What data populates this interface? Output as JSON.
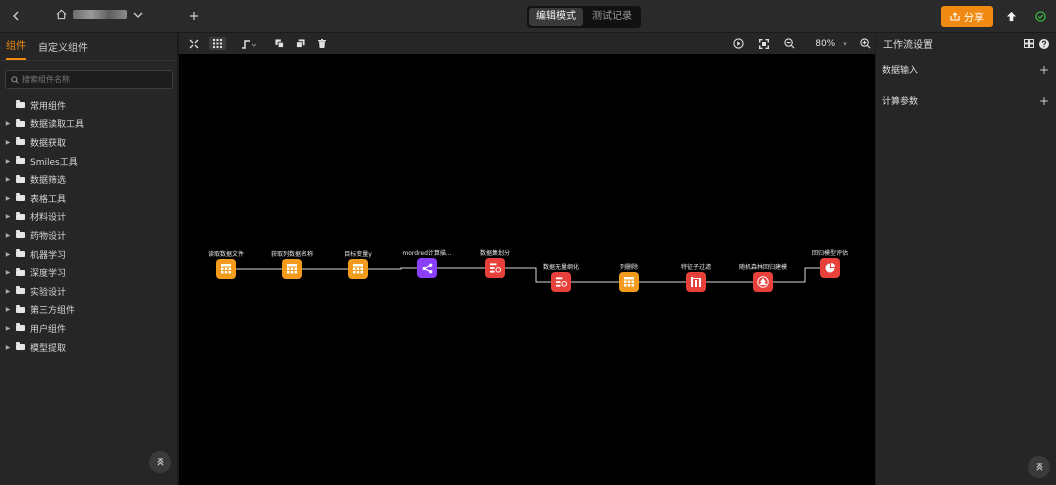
{
  "topbar": {
    "back_icon": "chevron-left-icon",
    "home_icon": "home-icon",
    "add_icon": "plus-icon",
    "modes": [
      "编辑模式",
      "测试记录"
    ],
    "active_mode": 0,
    "share_label": "分享",
    "share_icon": "share-icon",
    "push_icon": "upload-icon",
    "status_icon": "check-circle-icon"
  },
  "colors": {
    "accent": "#f08a12",
    "node_orange": "#f39b1c",
    "node_purple": "#8a3ffc",
    "node_red": "#e8413c"
  },
  "left_panel": {
    "tabs": [
      "组件",
      "自定义组件"
    ],
    "active_tab": 0,
    "search_placeholder": "搜索组件名称",
    "tree": [
      {
        "label": "常用组件",
        "expandable": false
      },
      {
        "label": "数据读取工具",
        "expandable": true
      },
      {
        "label": "数据获取",
        "expandable": true
      },
      {
        "label": "Smiles工具",
        "expandable": true
      },
      {
        "label": "数据筛选",
        "expandable": true
      },
      {
        "label": "表格工具",
        "expandable": true
      },
      {
        "label": "材料设计",
        "expandable": true
      },
      {
        "label": "药物设计",
        "expandable": true
      },
      {
        "label": "机器学习",
        "expandable": true
      },
      {
        "label": "深度学习",
        "expandable": true
      },
      {
        "label": "实验设计",
        "expandable": true
      },
      {
        "label": "第三方组件",
        "expandable": true
      },
      {
        "label": "用户组件",
        "expandable": true
      },
      {
        "label": "模型提取",
        "expandable": true
      }
    ],
    "collapse_icon": "double-chevron-up-icon"
  },
  "toolbar": {
    "zoom": "80%",
    "zoom_arrow": "▾"
  },
  "canvas": {
    "nodes": [
      {
        "label": "读取数据文件",
        "color": "orange",
        "icon": "table-icon"
      },
      {
        "label": "获取列数据名称",
        "color": "orange",
        "icon": "table-icon"
      },
      {
        "label": "目标变量y",
        "color": "orange",
        "icon": "table-icon"
      },
      {
        "label": "mordred计算描...",
        "color": "purple",
        "icon": "share-nodes-icon"
      },
      {
        "label": "数据集划分",
        "color": "red",
        "icon": "split-icon"
      },
      {
        "label": "数据无量纲化",
        "color": "red",
        "icon": "split-icon"
      },
      {
        "label": "列删除",
        "color": "orange",
        "icon": "table-icon"
      },
      {
        "label": "特征子过滤",
        "color": "red",
        "icon": "filter-bars-icon"
      },
      {
        "label": "随机森林回归建模",
        "color": "red",
        "icon": "forest-icon"
      },
      {
        "label": "回归模型评估",
        "color": "red",
        "icon": "chart-pie-icon"
      }
    ]
  },
  "right_panel": {
    "title": "工作流设置",
    "sections": [
      {
        "label": "数据输入",
        "action": "+"
      },
      {
        "label": "计算参数",
        "action": "+"
      }
    ],
    "collapse_icon": "double-chevron-up-icon"
  }
}
